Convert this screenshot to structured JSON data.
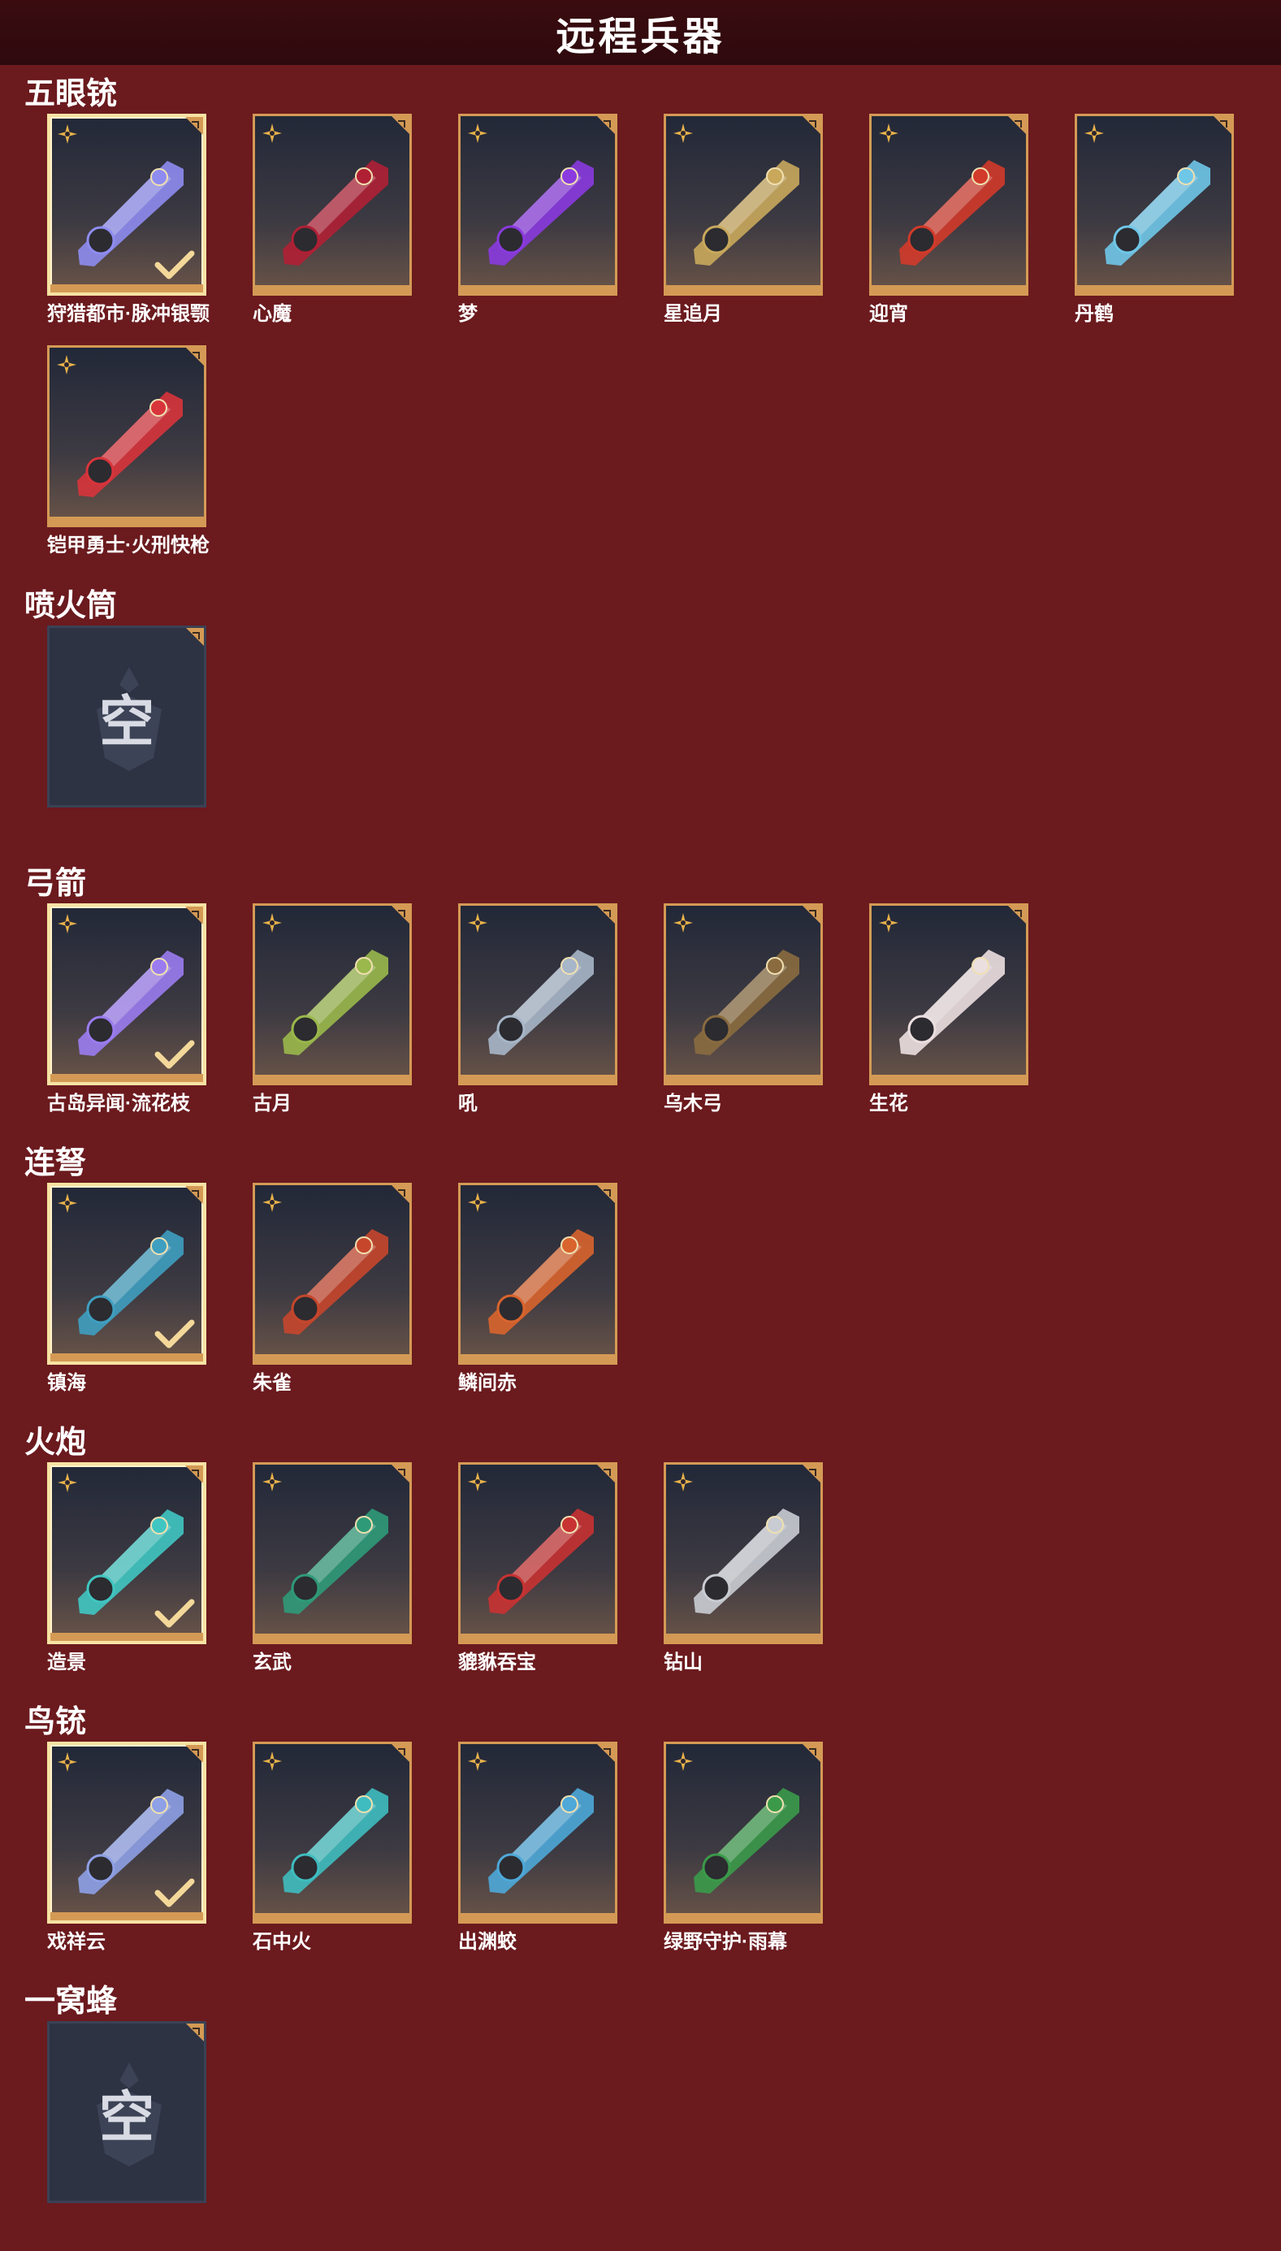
{
  "page": {
    "title": "远程兵器"
  },
  "colors": {
    "background": "#6b1a1e",
    "title_bar": "#2e0a0d",
    "card_border": "#d49a55",
    "selected_border": "#f7e2a3",
    "star_gold": "#e8b24a"
  },
  "sections": [
    {
      "title": "五眼铳",
      "items": [
        {
          "name": "狩猎都市·脉冲银颚",
          "selected": true,
          "icon": "purple-ice-gun-art",
          "accent": "#8e8cf0"
        },
        {
          "name": "心魔",
          "selected": false,
          "icon": "demon-gun-art",
          "accent": "#b02035"
        },
        {
          "name": "梦",
          "selected": false,
          "icon": "purple-dream-gun-art",
          "accent": "#8a3adf"
        },
        {
          "name": "星追月",
          "selected": false,
          "icon": "gold-gatling-art",
          "accent": "#c9a85c"
        },
        {
          "name": "迎宵",
          "selected": false,
          "icon": "red-dragon-gatling-art",
          "accent": "#d23a2a"
        },
        {
          "name": "丹鹤",
          "selected": false,
          "icon": "crane-gun-art",
          "accent": "#6fc7e8"
        }
      ]
    },
    {
      "title": "",
      "items": [
        {
          "name": "铠甲勇士·火刑快枪",
          "selected": false,
          "icon": "armored-red-gun-art",
          "accent": "#d8343b"
        }
      ]
    },
    {
      "title": "喷火筒",
      "items": [
        {
          "name": "",
          "empty": true,
          "empty_label": "空",
          "icon": "empty-slot-emblem"
        }
      ]
    },
    {
      "title": "弓箭",
      "items": [
        {
          "name": "古岛异闻·流花枝",
          "selected": true,
          "icon": "purple-bow-art",
          "accent": "#9b7cf0"
        },
        {
          "name": "古月",
          "selected": false,
          "icon": "green-quiver-bow-art",
          "accent": "#9ab84b"
        },
        {
          "name": "吼",
          "selected": false,
          "icon": "steel-bow-art",
          "accent": "#a7b6c8"
        },
        {
          "name": "乌木弓",
          "selected": false,
          "icon": "wooden-bow-art",
          "accent": "#8a6b3f"
        },
        {
          "name": "生花",
          "selected": false,
          "icon": "flower-bow-art",
          "accent": "#ecdfe0"
        }
      ]
    },
    {
      "title": "连弩",
      "items": [
        {
          "name": "镇海",
          "selected": true,
          "icon": "sea-crossbow-art",
          "accent": "#3f9fc0"
        },
        {
          "name": "朱雀",
          "selected": false,
          "icon": "phoenix-crossbow-art",
          "accent": "#c6462c"
        },
        {
          "name": "鳞间赤",
          "selected": false,
          "icon": "fish-crossbow-art",
          "accent": "#d9642d"
        }
      ]
    },
    {
      "title": "火炮",
      "items": [
        {
          "name": "造景",
          "selected": true,
          "icon": "cyan-cannon-art",
          "accent": "#40c6c2"
        },
        {
          "name": "玄武",
          "selected": false,
          "icon": "turtle-cannon-art",
          "accent": "#2f9a78"
        },
        {
          "name": "貔貅吞宝",
          "selected": false,
          "icon": "red-gold-cannon-art",
          "accent": "#c83232"
        },
        {
          "name": "钻山",
          "selected": false,
          "icon": "silver-cannon-art",
          "accent": "#c9ccd2"
        }
      ]
    },
    {
      "title": "鸟铳",
      "items": [
        {
          "name": "戏祥云",
          "selected": true,
          "icon": "cloud-musket-art",
          "accent": "#8ea0e6"
        },
        {
          "name": "石中火",
          "selected": false,
          "icon": "cyan-musket-art",
          "accent": "#3fbcbf"
        },
        {
          "name": "出渊蛟",
          "selected": false,
          "icon": "dragon-musket-art",
          "accent": "#4ea8d8"
        },
        {
          "name": "绿野守护·雨幕",
          "selected": false,
          "icon": "green-musket-art",
          "accent": "#3b9a4a"
        }
      ]
    },
    {
      "title": "一窝蜂",
      "items": [
        {
          "name": "",
          "empty": true,
          "empty_label": "空",
          "icon": "empty-slot-emblem"
        }
      ]
    }
  ]
}
